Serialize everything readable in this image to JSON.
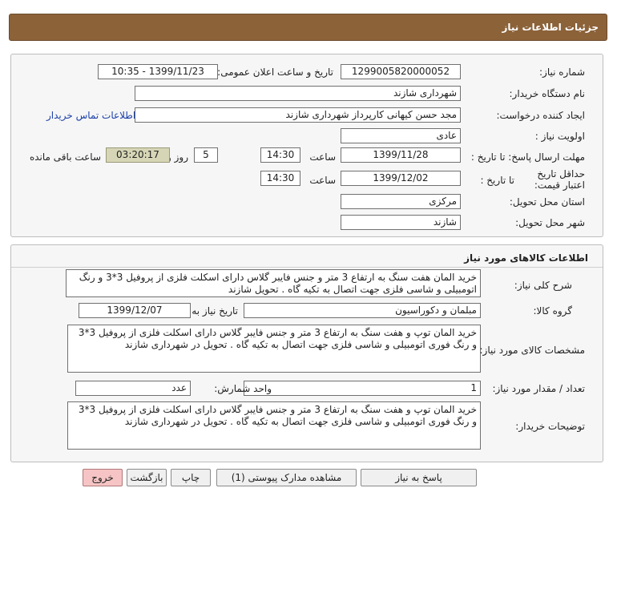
{
  "header": {
    "title": "جزئیات اطلاعات نیاز"
  },
  "info": {
    "need_number_label": "شماره نیاز:",
    "need_number": "1299005820000052",
    "announce_label": "تاریخ و ساعت اعلان عمومی:",
    "announce_value": "1399/11/23 - 10:35",
    "buyer_org_label": "نام دستگاه خریدار:",
    "buyer_org": "شهرداری شازند",
    "requester_label": "ایجاد کننده درخواست:",
    "requester": "مجد حسن کیهانی کارپرداز شهرداری شازند",
    "contact_link": "اطلاعات تماس خریدار",
    "priority_label": "اولویت نیاز :",
    "priority": "عادی",
    "deadline_label": "مهلت ارسال پاسخ: تا تاریخ :",
    "deadline_date": "1399/11/28",
    "time_label": "ساعت",
    "deadline_time": "14:30",
    "days": "5",
    "days_label": "روز و",
    "remaining": "03:20:17",
    "remaining_label": "ساعت باقی مانده",
    "min_validity_label": "حداقل تاریخ اعتبار قیمت:",
    "to_date_label": "تا تاریخ :",
    "validity_date": "1399/12/02",
    "validity_time": "14:30",
    "province_label": "استان محل تحویل:",
    "province": "مرکزی",
    "city_label": "شهر محل تحویل:",
    "city": "شازند"
  },
  "goods": {
    "section_title": "اطلاعات کالاهای مورد نیاز",
    "general_desc_label": "شرح کلی نیاز:",
    "general_desc": "خرید المان هفت سنگ به ارتفاع 3 متر و جنس فایبر گلاس دارای اسکلت فلزی از پروفیل 3*3 و رنگ اتومبیلی و شاسی فلزی جهت اتصال به تکیه گاه . تحویل شازند",
    "group_label": "گروه کالا:",
    "group": "مبلمان و دکوراسیون",
    "need_date_label": "تاریخ نیاز به کالا:",
    "need_date": "1399/12/07",
    "spec_label": "مشخصات کالای مورد نیاز:",
    "spec": "خرید المان توپ و هفت سنگ به ارتفاع 3 متر و جنس فایبر گلاس دارای اسکلت فلزی از پروفیل 3*3 و رنگ فوری اتومبیلی و شاسی فلزی جهت اتصال به تکیه گاه . تحویل در شهرداری شازند",
    "qty_label": "تعداد / مقدار مورد نیاز:",
    "qty": "1",
    "unit_label": "واحد شمارش:",
    "unit": "عدد",
    "buyer_notes_label": "توضیحات خریدار:",
    "buyer_notes": "خرید المان توپ و هفت سنگ به ارتفاع 3 متر و جنس فایبر گلاس دارای اسکلت فلزی از پروفیل 3*3 و رنگ فوری اتومبیلی و شاسی فلزی جهت اتصال به تکیه گاه . تحویل در شهرداری شازند"
  },
  "buttons": {
    "reply": "پاسخ به نیاز",
    "attachments": "مشاهده مدارک پیوستی (1)",
    "print": "چاپ",
    "back": "بازگشت",
    "exit": "خروج"
  }
}
